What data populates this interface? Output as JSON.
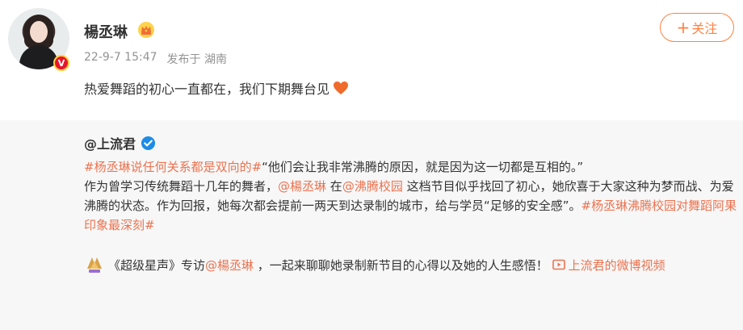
{
  "user": {
    "name": "楊丞琳",
    "badge_letter": "V"
  },
  "follow_button": {
    "label": "关注",
    "plus": "+"
  },
  "meta": {
    "time": "22-9-7 15:47",
    "location": "发布于 湖南"
  },
  "post": {
    "text": "热爱舞蹈的初心一直都在，我们下期舞台见"
  },
  "repost": {
    "author": "@上流君",
    "hashtag1": "#杨丞琳说任何关系都是双向的#",
    "quote": "“他们会让我非常沸腾的原因，就是因为这一切都是互相的。”",
    "p1_a": "作为曾学习传统舞蹈十几年的舞者，",
    "mention1": "@楊丞琳",
    "p1_b": " 在",
    "mention2": "@沸腾校园",
    "p1_c": " 这档节目似乎找回了初心，她欣喜于大家这种为梦而战、为爱沸腾的状态。作为回报，她每次都会提前一两天到达录制的城市，给与学员“足够的安全感”。",
    "hashtag2": "#杨丞琳沸腾校园对舞蹈阿果印象最深刻#",
    "p2_a": "《超级星声》专访",
    "mention3": "@楊丞琳",
    "p2_b": " ，一起来聊聊她录制新节目的心得以及她的人生感悟！",
    "video_link": "上流君的微博视频"
  },
  "colors": {
    "accent": "#ff8140",
    "link": "#eb7350",
    "meta": "#939393",
    "repost_bg": "#f7f7f7"
  },
  "icons": [
    "crown-icon",
    "heart-icon",
    "verified-icon",
    "ssq-logo-icon",
    "video-icon"
  ]
}
